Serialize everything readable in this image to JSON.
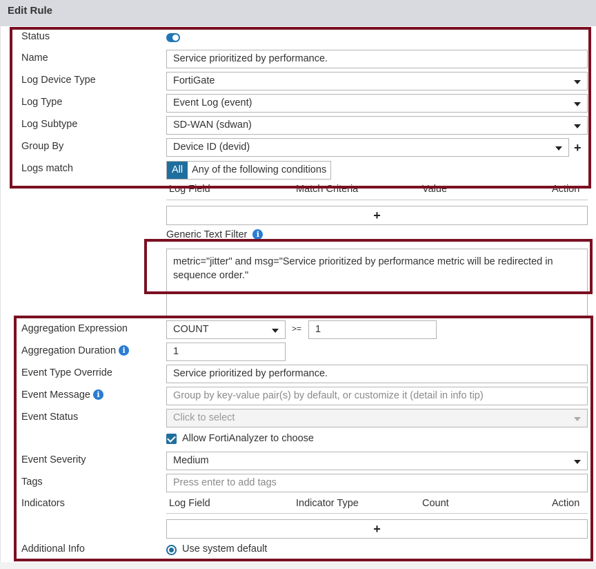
{
  "header": {
    "title": "Edit Rule"
  },
  "form": {
    "status_label": "Status",
    "name_label": "Name",
    "name_value": "Service prioritized by performance.",
    "log_device_type_label": "Log Device Type",
    "log_device_type_value": "FortiGate",
    "log_type_label": "Log Type",
    "log_type_value": "Event Log (event)",
    "log_subtype_label": "Log Subtype",
    "log_subtype_value": "SD-WAN (sdwan)",
    "group_by_label": "Group By",
    "group_by_value": "Device ID (devid)",
    "logs_match_label": "Logs match",
    "logs_match_all": "All",
    "logs_match_any": "Any of the following conditions",
    "filter_columns": [
      "Log Field",
      "Match Criteria",
      "Value",
      "Action"
    ],
    "generic_text_filter_label": "Generic Text Filter",
    "generic_text_filter_value": "metric=\"jitter\" and msg=\"Service prioritized by performance metric will be redirected in sequence order.\"",
    "aggregation_expression_label": "Aggregation Expression",
    "aggregation_function": "COUNT",
    "aggregation_operator": ">=",
    "aggregation_threshold": "1",
    "aggregation_duration_label": "Aggregation Duration",
    "aggregation_duration_value": "1",
    "event_type_override_label": "Event Type Override",
    "event_type_override_value": "Service prioritized by performance.",
    "event_message_label": "Event Message",
    "event_message_placeholder": "Group by key-value pair(s) by default, or customize it (detail in info tip)",
    "event_status_label": "Event Status",
    "event_status_placeholder": "Click to select",
    "allow_choose_label": "Allow FortiAnalyzer to choose",
    "event_severity_label": "Event Severity",
    "event_severity_value": "Medium",
    "tags_label": "Tags",
    "tags_placeholder": "Press enter to add tags",
    "indicators_label": "Indicators",
    "indicator_columns": [
      "Log Field",
      "Indicator Type",
      "Count",
      "Action"
    ],
    "additional_info_label": "Additional Info",
    "additional_info_option": "Use system default"
  },
  "icons": {
    "info": "info-icon",
    "plus": "plus-icon",
    "dropdown": "chevron-down-icon"
  },
  "colors": {
    "accent": "#1f6f9e",
    "toggle_on": "#1f78b4",
    "highlight": "#7a1022",
    "header_bg": "#d8dadf"
  }
}
